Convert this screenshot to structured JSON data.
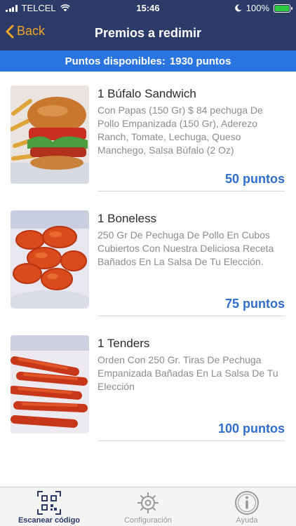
{
  "status_bar": {
    "carrier": "TELCEL",
    "time": "15:46",
    "battery": "100%"
  },
  "nav": {
    "back_label": "Back",
    "title": "Premios a redimir"
  },
  "points_banner": {
    "label": "Puntos disponibles:",
    "value": "1930 puntos"
  },
  "rewards": [
    {
      "name": "1 Búfalo Sandwich",
      "description": "Con Papas (150 Gr) $ 84 pechuga De Pollo Empanizada (150 Gr), Aderezo Ranch, Tomate, Lechuga, Queso Manchego, Salsa Búfalo (2 Oz)",
      "price": "50 puntos",
      "image": "sandwich-photo"
    },
    {
      "name": "1 Boneless",
      "description": "250 Gr De Pechuga De Pollo En Cubos Cubiertos Con Nuestra Deliciosa Receta Bañados En La Salsa De Tu Elección.",
      "price": "75 puntos",
      "image": "boneless-photo"
    },
    {
      "name": "1 Tenders",
      "description": "Orden Con 250 Gr. Tiras De Pechuga Empanizada Bañadas En La Salsa De Tu Elección",
      "price": "100 puntos",
      "image": "tenders-photo"
    }
  ],
  "tabs": [
    {
      "label": "Escanear código",
      "icon": "qr-code-icon",
      "active": true
    },
    {
      "label": "Configuración",
      "icon": "gear-icon",
      "active": false
    },
    {
      "label": "Ayuda",
      "icon": "info-icon",
      "active": false
    }
  ],
  "colors": {
    "nav_bg": "#2b3a67",
    "banner_bg": "#2a74e0",
    "back_accent": "#f5a623",
    "price": "#2f6ecb"
  }
}
